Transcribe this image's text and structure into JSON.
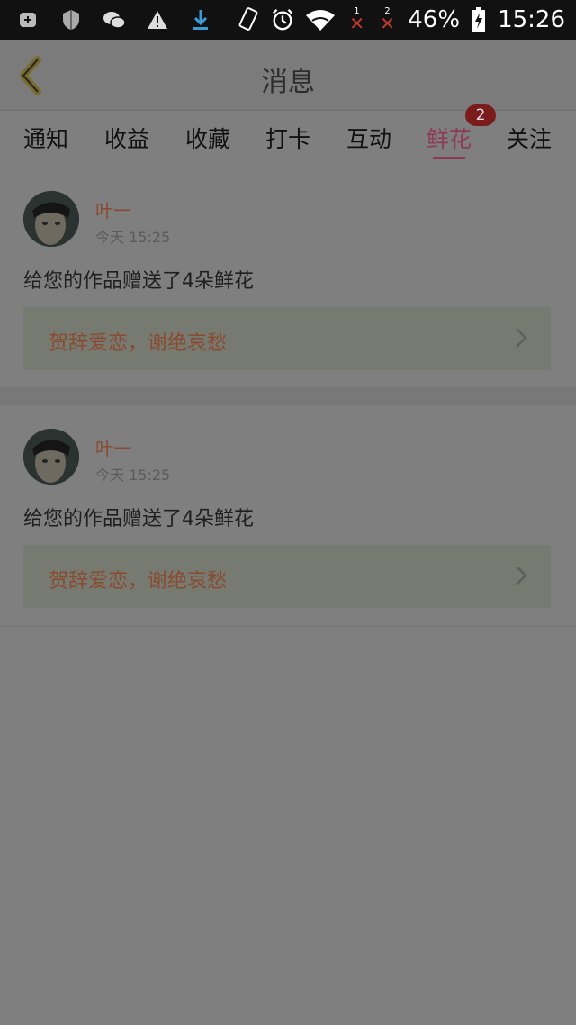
{
  "status_bar": {
    "battery_percent": "46%",
    "time": "15:26",
    "sim1_label": "1",
    "sim2_label": "2"
  },
  "header": {
    "title": "消息"
  },
  "tabs": {
    "items": [
      "通知",
      "收益",
      "收藏",
      "打卡",
      "互动",
      "鲜花",
      "关注"
    ],
    "active": "鲜花",
    "badge": "2"
  },
  "messages": [
    {
      "name": "叶一",
      "time": "今天 15:25",
      "text": "给您的作品赠送了4朵鲜花",
      "quote": "贺辞爱恋，谢绝哀愁"
    },
    {
      "name": "叶一",
      "time": "今天 15:25",
      "text": "给您的作品赠送了4朵鲜花",
      "quote": "贺辞爱恋，谢绝哀愁"
    }
  ],
  "colors": {
    "overlay_bg": "#7f7f7f",
    "accent": "#8e3a55",
    "name_color": "#8a4a2f",
    "badge_bg": "#7b1c1c"
  }
}
